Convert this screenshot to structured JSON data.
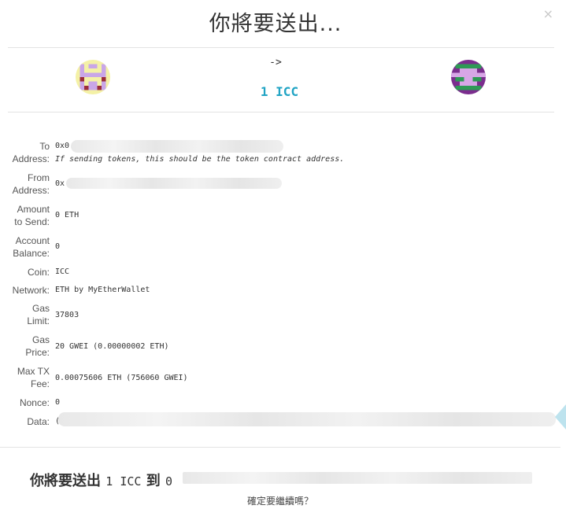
{
  "modal": {
    "title": "你將要送出...",
    "close_label": "×"
  },
  "transfer": {
    "arrow": "->",
    "amount": "1 ICC",
    "from_identicon": "identicon-yellow-purple",
    "to_identicon": "identicon-purple-green"
  },
  "details": {
    "to": {
      "label_1": "To",
      "label_2": "Address:",
      "value": "0x0",
      "hint": "If sending tokens, this should be the token contract address."
    },
    "from": {
      "label_1": "From",
      "label_2": "Address:",
      "value": "0x"
    },
    "amount": {
      "label_1": "Amount",
      "label_2": "to Send:",
      "value": "0 ETH"
    },
    "balance": {
      "label_1": "Account",
      "label_2": "Balance:",
      "value": "0"
    },
    "coin": {
      "label": "Coin:",
      "value": "ICC"
    },
    "network": {
      "label": "Network:",
      "value": "ETH by MyEtherWallet"
    },
    "gas_limit": {
      "label_1": "Gas",
      "label_2": "Limit:",
      "value": "37803"
    },
    "gas_price": {
      "label_1": "Gas",
      "label_2": "Price:",
      "value": "20 GWEI (0.00000002 ETH)"
    },
    "max_fee": {
      "label_1": "Max TX",
      "label_2": "Fee:",
      "value": "0.00075606 ETH (756060 GWEI)"
    },
    "nonce": {
      "label": "Nonce:",
      "value": "0"
    },
    "data": {
      "label": "Data:",
      "value": "("
    }
  },
  "footer": {
    "summary_prefix": "你將要送出",
    "summary_amount": "1 ICC",
    "summary_to": "到",
    "summary_address_start": "0",
    "confirm": "確定要繼續嗎？"
  },
  "colors": {
    "accent": "#21a4c4",
    "divider": "#e3e3e3"
  }
}
